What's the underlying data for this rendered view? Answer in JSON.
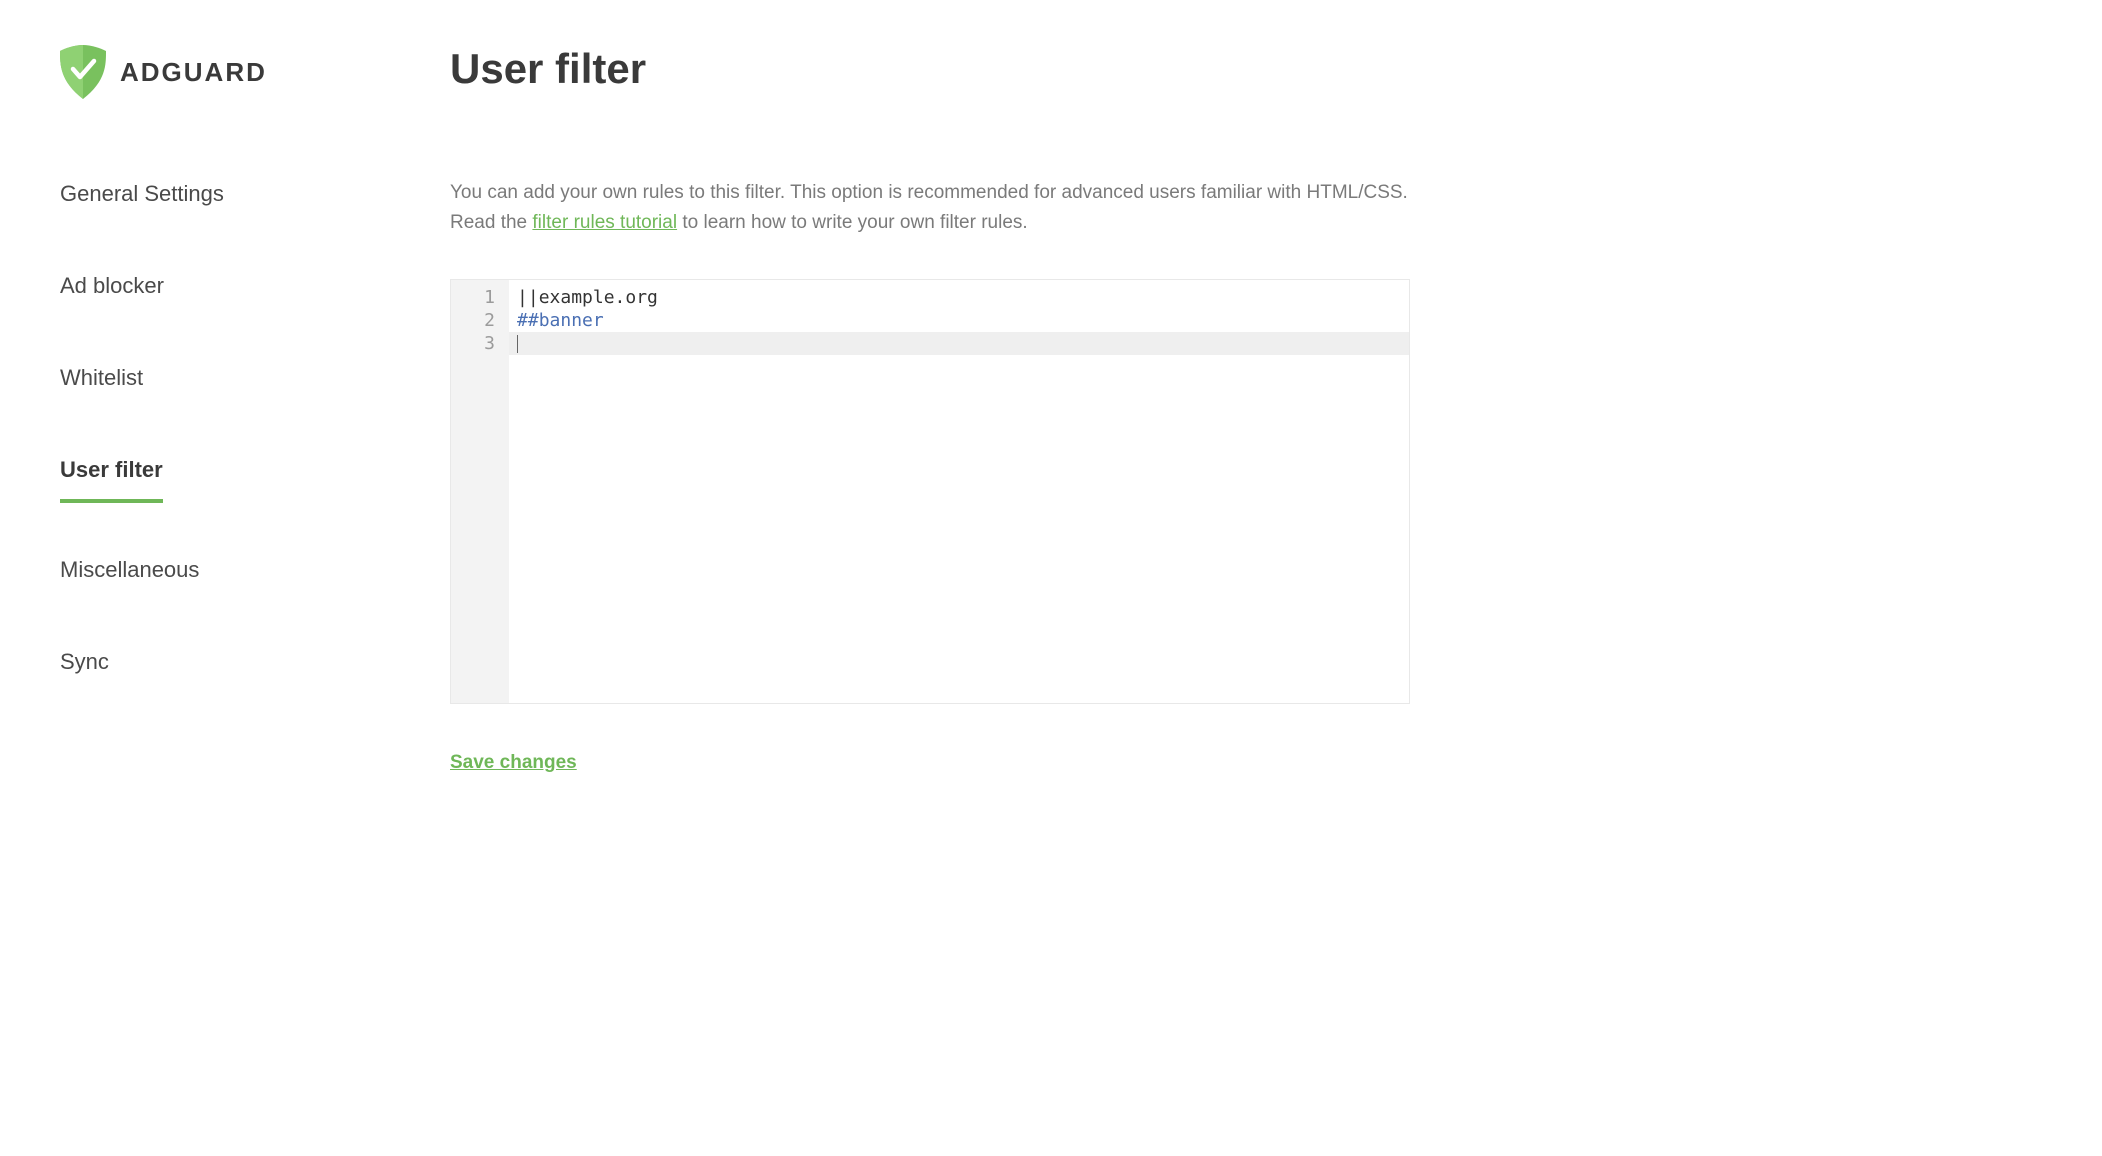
{
  "brand": {
    "name": "ADGUARD"
  },
  "sidebar": {
    "items": [
      {
        "label": "General Settings",
        "active": false
      },
      {
        "label": "Ad blocker",
        "active": false
      },
      {
        "label": "Whitelist",
        "active": false
      },
      {
        "label": "User filter",
        "active": true
      },
      {
        "label": "Miscellaneous",
        "active": false
      },
      {
        "label": "Sync",
        "active": false
      }
    ]
  },
  "main": {
    "title": "User filter",
    "desc_before_link": "You can add your own rules to this filter. This option is recommended for advanced users familiar with HTML/CSS. Read the ",
    "link_text": "filter rules tutorial",
    "desc_after_link": " to learn how to write your own filter rules.",
    "save_label": "Save changes"
  },
  "editor": {
    "line_numbers": [
      "1",
      "2",
      "3"
    ],
    "lines": [
      {
        "tokens": [
          {
            "t": "||",
            "cls": "tok-punc"
          },
          {
            "t": "example.org",
            "cls": "tok-default"
          }
        ],
        "active": false
      },
      {
        "tokens": [
          {
            "t": "##",
            "cls": "tok-hash"
          },
          {
            "t": "banner",
            "cls": "tok-banner"
          }
        ],
        "active": false
      },
      {
        "tokens": [],
        "active": true
      }
    ]
  }
}
